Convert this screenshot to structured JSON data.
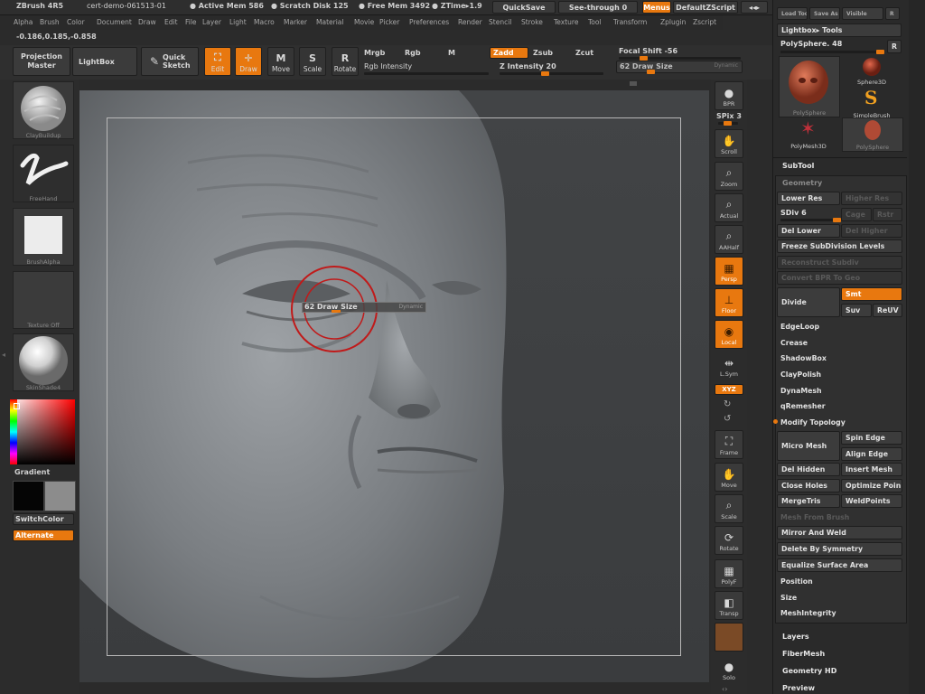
{
  "titlebar": {
    "app": "ZBrush 4R5",
    "doc": "cert-demo-061513-01",
    "active_mem": "● Active Mem 586",
    "scratch": "● Scratch Disk 125",
    "free_mem": "● Free Mem 3492",
    "ztime": "● ZTime▸1.9",
    "quicksave": "QuickSave",
    "seethrough": "See-through  0",
    "menus": "Menus",
    "defaultzscript": "DefaultZScript"
  },
  "menu": [
    "Alpha",
    "Brush",
    "Color",
    "Document",
    "Draw",
    "Edit",
    "File",
    "Layer",
    "Light",
    "Macro",
    "Marker",
    "Material",
    "Movie",
    "Picker",
    "Preferences",
    "Render",
    "Stencil",
    "Stroke",
    "Texture",
    "Tool",
    "Transform",
    "Zplugin",
    "Zscript"
  ],
  "coords": "-0.186,0.185,-0.858",
  "toolbar": {
    "projection_master": "Projection Master",
    "lightbox": "LightBox",
    "quick_sketch": "Quick Sketch",
    "edit": "Edit",
    "draw": "Draw",
    "move": "Move",
    "scale": "Scale",
    "rotate": "Rotate",
    "mrgb": "Mrgb",
    "rgb": "Rgb",
    "m": "M",
    "rgb_intensity": "Rgb Intensity",
    "zadd": "Zadd",
    "zsub": "Zsub",
    "zcut": "Zcut",
    "z_intensity": "Z Intensity 20",
    "z_intensity_value": 20,
    "focal_shift": "Focal Shift -56",
    "focal_shift_value": -56,
    "draw_size": "62 Draw Size",
    "draw_size_value": 62,
    "dynamic": "Dynamic"
  },
  "left_tray": {
    "brush": "ClayBuildup",
    "stroke": "FreeHand",
    "alpha": "BrushAlpha",
    "texture": "Texture Off",
    "material": "SkinShade4",
    "gradient": "Gradient",
    "switchcolor": "SwitchColor",
    "alternate": "Alternate"
  },
  "canvas": {
    "popup_label": "62 Draw Size",
    "popup_dynamic": "Dynamic"
  },
  "right_shelf": [
    "BPR",
    "SPix 3",
    "Scroll",
    "Zoom",
    "Actual",
    "AAHalf",
    "Persp",
    "Floor",
    "Local",
    "L.Sym",
    "XYZ",
    "Frame",
    "Move",
    "Scale",
    "Rotate",
    "PolyF",
    "Transp",
    "Solo"
  ],
  "tool_panel": {
    "top_buttons": [
      "Load Tool",
      "Save As",
      "Visible",
      "R"
    ],
    "lightbox_tools": "Lightbox▸ Tools",
    "polysphere": "PolySphere. 48",
    "r": "R",
    "thumbs": [
      "PolySphere",
      "Sphere3D",
      "SimpleBrush",
      "PolyMesh3D",
      "PolySphere"
    ],
    "subtool": "SubTool",
    "geometry": "Geometry",
    "lower_res": "Lower Res",
    "higher_res": "Higher Res",
    "sdiv": "SDiv 6",
    "sdiv_value": 6,
    "cage": "Cage",
    "rstr": "Rstr",
    "del_lower": "Del Lower",
    "del_higher": "Del Higher",
    "freeze": "Freeze SubDivision Levels",
    "reconstruct": "Reconstruct Subdiv",
    "convert": "Convert BPR To Geo",
    "divide": "Divide",
    "smt": "Smt",
    "suv": "Suv",
    "reuv": "ReUV",
    "edgeloop": "EdgeLoop",
    "crease": "Crease",
    "shadowbox": "ShadowBox",
    "claypolish": "ClayPolish",
    "dynamesh": "DynaMesh",
    "qremesher": "qRemesher",
    "modify_topology": "Modify Topology",
    "micro_mesh": "Micro Mesh",
    "spin_edge": "Spin Edge",
    "align_edge": "Align Edge",
    "del_hidden": "Del Hidden",
    "insert_mesh": "Insert Mesh",
    "close_holes": "Close Holes",
    "optimize_points": "Optimize Poin",
    "mergetris": "MergeTris",
    "weldpoints": "WeldPoints",
    "mesh_from_brush": "Mesh From Brush",
    "mirror_and_weld": "Mirror And Weld",
    "delete_by_symmetry": "Delete By Symmetry",
    "equalize": "Equalize Surface Area",
    "position": "Position",
    "size": "Size",
    "meshintegrity": "MeshIntegrity",
    "layers": "Layers",
    "fibermesh": "FiberMesh",
    "geometry_hd": "Geometry HD",
    "preview": "Preview"
  },
  "colors": {
    "accent": "#e8780f",
    "panel": "#2a2a2a",
    "canvas": "#404244"
  }
}
